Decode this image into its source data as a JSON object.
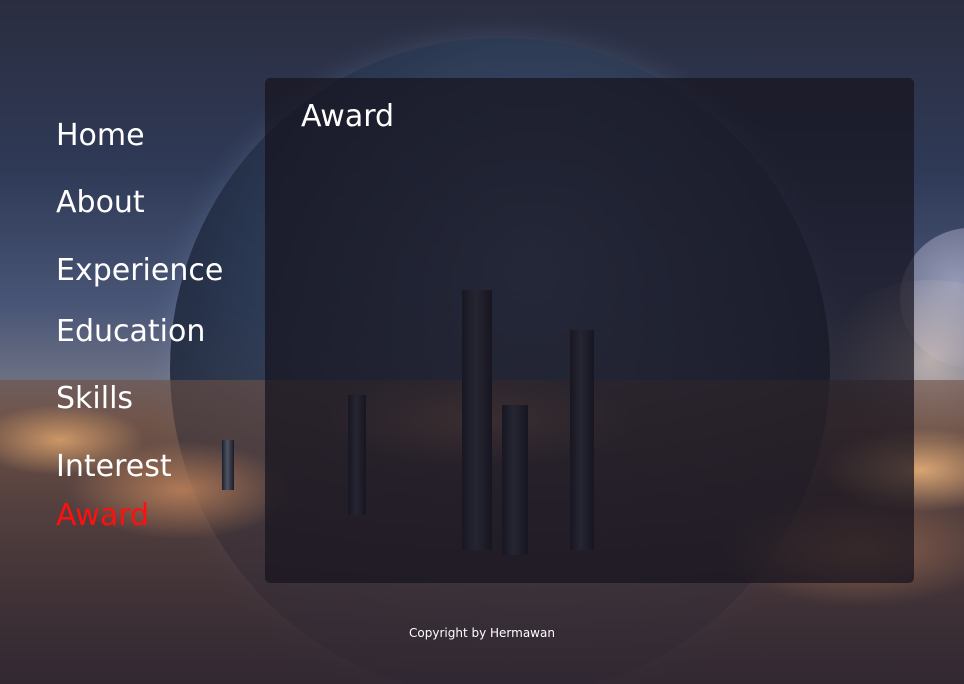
{
  "nav": {
    "items": [
      {
        "label": "Home",
        "active": false
      },
      {
        "label": "About",
        "active": false
      },
      {
        "label": "Experience",
        "active": false
      },
      {
        "label": "Education",
        "active": false
      },
      {
        "label": "Skills",
        "active": false
      },
      {
        "label": "Interest",
        "active": false
      },
      {
        "label": "Award",
        "active": true
      }
    ]
  },
  "panel": {
    "title": "Award"
  },
  "footer": {
    "text": "Copyright by Hermawan"
  },
  "colors": {
    "active_nav": "#ff1010",
    "text": "#ffffff",
    "panel_background": "rgba(22,20,30,0.72)"
  },
  "background": {
    "image_semantic": "sci-fi city above clouds with planet"
  }
}
